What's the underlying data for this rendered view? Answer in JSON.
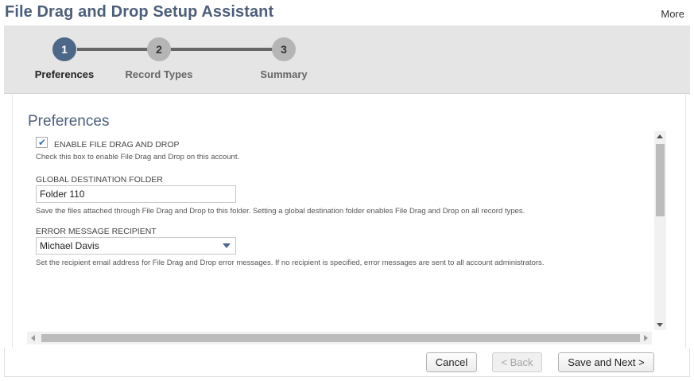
{
  "header": {
    "title": "File Drag and Drop Setup Assistant",
    "more_label": "More"
  },
  "wizard": {
    "steps": [
      {
        "number": "1",
        "label": "Preferences",
        "state": "active"
      },
      {
        "number": "2",
        "label": "Record Types",
        "state": "inactive"
      },
      {
        "number": "3",
        "label": "Summary",
        "state": "inactive"
      }
    ]
  },
  "preferences": {
    "section_title": "Preferences",
    "enable": {
      "checked": true,
      "label": "ENABLE FILE DRAG AND DROP",
      "help": "Check this box to enable File Drag and Drop on this account."
    },
    "destination_folder": {
      "label": "GLOBAL DESTINATION FOLDER",
      "value": "Folder 110",
      "help": "Save the files attached through File Drag and Drop to this folder. Setting a global destination folder enables File Drag and Drop on all record types."
    },
    "error_recipient": {
      "label": "ERROR MESSAGE RECIPIENT",
      "value": "Michael Davis",
      "help": "Set the recipient email address for File Drag and Drop error messages. If no recipient is specified, error messages are sent to all account administrators."
    }
  },
  "footer": {
    "cancel_label": "Cancel",
    "back_label": "< Back",
    "next_label": "Save and Next >"
  },
  "colors": {
    "title": "#4d5f79",
    "active_step": "#4d6788",
    "inactive_step": "#b5b5b5",
    "wizard_bg": "#e5e5e5",
    "checkmark": "#3f6fb5"
  }
}
